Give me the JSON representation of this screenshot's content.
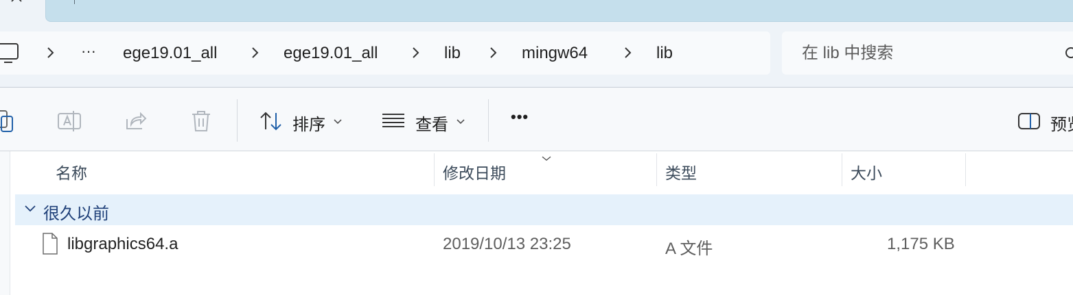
{
  "breadcrumb": {
    "overflow_label": "···",
    "items": [
      "ege19.01_all",
      "ege19.01_all",
      "lib",
      "mingw64",
      "lib"
    ]
  },
  "search": {
    "placeholder": "在 lib 中搜索"
  },
  "toolbar": {
    "sort_label": "排序",
    "view_label": "查看",
    "more_label": "•••",
    "preview_label": "预览"
  },
  "columns": {
    "name": "名称",
    "modified": "修改日期",
    "type": "类型",
    "size": "大小"
  },
  "group": {
    "label": "很久以前"
  },
  "files": [
    {
      "name": "libgraphics64.a",
      "modified": "2019/10/13 23:25",
      "type": "A 文件",
      "size": "1,175 KB"
    }
  ],
  "icons": {
    "computer": "computer-icon",
    "search": "search-icon",
    "copy": "copy-icon",
    "rename": "rename-icon",
    "share": "share-icon",
    "delete": "trash-icon",
    "sort": "sort-icon",
    "view": "view-icon",
    "preview": "preview-pane-icon",
    "file": "file-icon"
  },
  "colors": {
    "group_bg": "#e5f1fb",
    "group_text": "#1e3f78",
    "accent_blue": "#1f5fa8",
    "tab_bg": "#c5dfec"
  }
}
